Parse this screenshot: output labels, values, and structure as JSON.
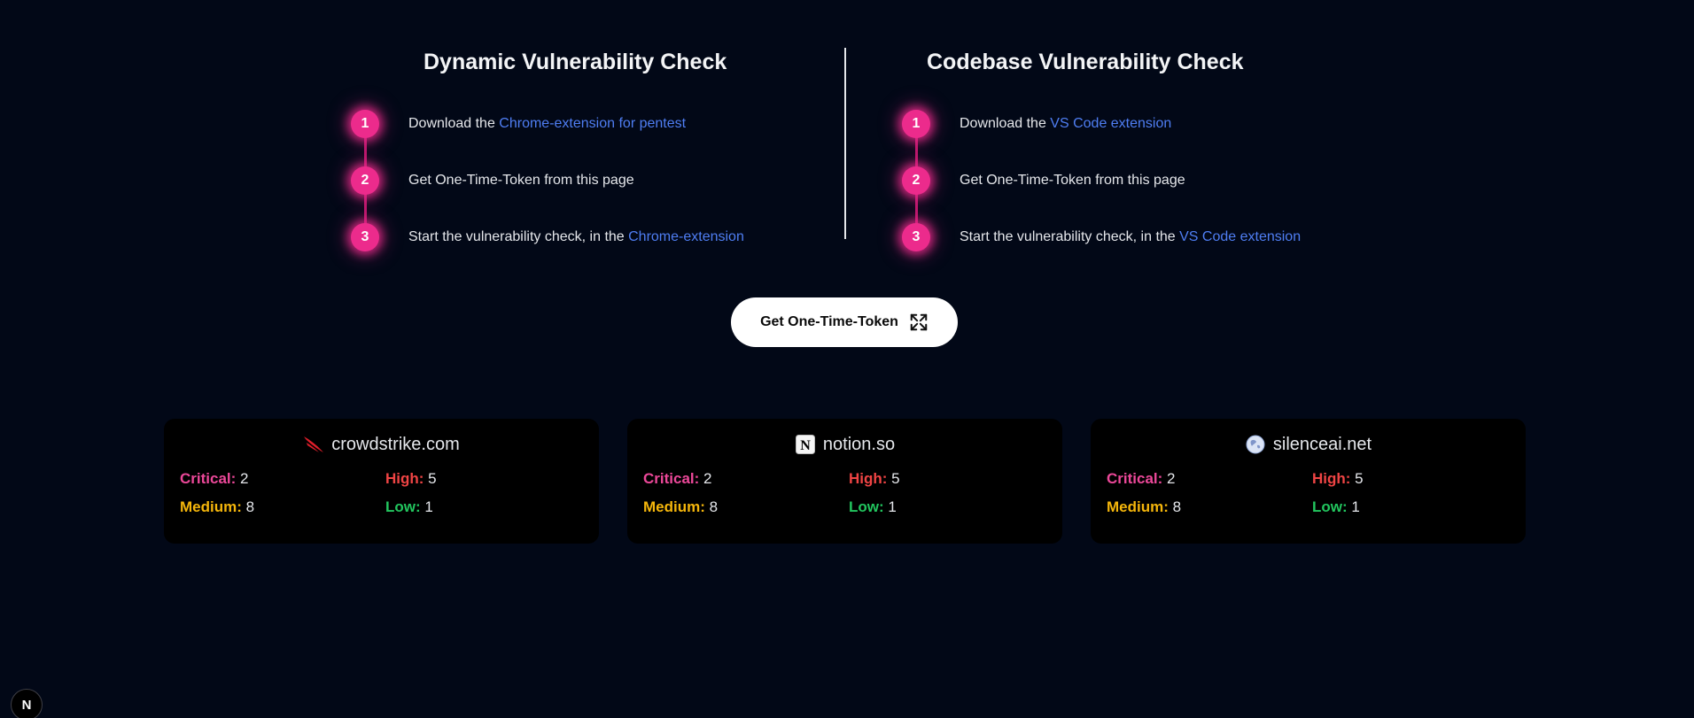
{
  "dynamic": {
    "title": "Dynamic Vulnerability Check",
    "steps": [
      {
        "num": "1",
        "text": "Download the ",
        "link": "Chrome-extension for pentest"
      },
      {
        "num": "2",
        "text": "Get One-Time-Token from this page",
        "link": ""
      },
      {
        "num": "3",
        "text": "Start the vulnerability check, in the ",
        "link": "Chrome-extension"
      }
    ]
  },
  "codebase": {
    "title": "Codebase Vulnerability Check",
    "steps": [
      {
        "num": "1",
        "text": "Download the ",
        "link": "VS Code extension"
      },
      {
        "num": "2",
        "text": "Get One-Time-Token from this page",
        "link": ""
      },
      {
        "num": "3",
        "text": "Start the vulnerability check, in the ",
        "link": "VS Code extension"
      }
    ]
  },
  "cta": {
    "label": "Get One-Time-Token",
    "icon": "expand-icon"
  },
  "cards": [
    {
      "domain": "crowdstrike.com",
      "logo": "crowdstrike-logo",
      "critical_label": "Critical:",
      "critical": "2",
      "high_label": "High:",
      "high": "5",
      "medium_label": "Medium:",
      "medium": "8",
      "low_label": "Low:",
      "low": "1"
    },
    {
      "domain": "notion.so",
      "logo": "notion-logo",
      "critical_label": "Critical:",
      "critical": "2",
      "high_label": "High:",
      "high": "5",
      "medium_label": "Medium:",
      "medium": "8",
      "low_label": "Low:",
      "low": "1"
    },
    {
      "domain": "silenceai.net",
      "logo": "globe-logo",
      "critical_label": "Critical:",
      "critical": "2",
      "high_label": "High:",
      "high": "5",
      "medium_label": "Medium:",
      "medium": "8",
      "low_label": "Low:",
      "low": "1"
    }
  ],
  "badge": {
    "letter": "N"
  },
  "colors": {
    "background": "#020817",
    "accent_pink": "#ec2b8c",
    "link_blue": "#4f7ef3",
    "critical": "#ec4899",
    "high": "#ef4444",
    "medium": "#f5b60b",
    "low": "#22c55e"
  }
}
